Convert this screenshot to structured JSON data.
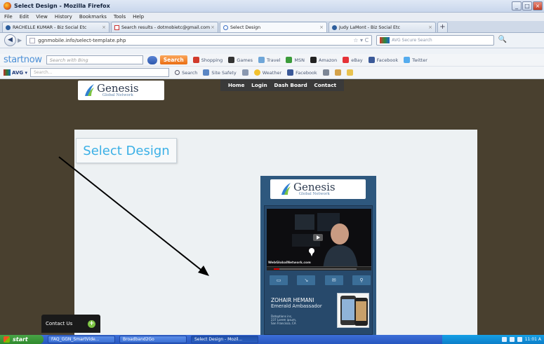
{
  "window": {
    "title": "Select Design - Mozilla Firefox",
    "min": "_",
    "max": "□",
    "close": "×"
  },
  "menu": [
    "File",
    "Edit",
    "View",
    "History",
    "Bookmarks",
    "Tools",
    "Help"
  ],
  "tabs": [
    {
      "label": "RACHELLE KUMAR - Biz Social Etc",
      "icon": "site-icon"
    },
    {
      "label": "Search results - dotmobietc@gmail.com - ...",
      "icon": "gmail-icon"
    },
    {
      "label": "Select Design",
      "icon": "search-icon"
    },
    {
      "label": "Judy LaMont - Biz Social Etc",
      "icon": "site-icon"
    }
  ],
  "tab_close": "×",
  "new_tab": "+",
  "nav": {
    "url": "ggnmobile.info/select-template.php",
    "url_right": "☆ ▾ C",
    "search_placeholder": "AVG Secure Search",
    "search_go": "🔍"
  },
  "startnow_bar": {
    "brand": "startnow",
    "search_placeholder": "Search with Bing",
    "search_button": "Search",
    "items": [
      "Shopping",
      "Games",
      "Travel",
      "MSN",
      "Amazon",
      "eBay",
      "Facebook",
      "Twitter"
    ]
  },
  "avg_bar": {
    "brand": "AVG ▾",
    "search_placeholder": "Search...",
    "items": [
      "Search",
      "Site Safety",
      "Weather",
      "Facebook"
    ]
  },
  "site": {
    "logo_word": "Genesis",
    "logo_sub": "Global Network",
    "nav": [
      "Home",
      "Login",
      "Dash Board",
      "Contact"
    ],
    "heading": "Select Design",
    "contact_label": "Contact Us",
    "contact_plus": "+"
  },
  "preview": {
    "logo_word": "Genesis",
    "logo_sub": "Global Network",
    "video_caption": "WebGlobalNetwork.com",
    "icons": [
      "▭",
      "↘",
      "✉",
      "⚲"
    ],
    "name": "ZOHAIR HEMANI",
    "title": "Emerald Ambassador",
    "address": [
      "Dotoptions inc,",
      "237 Lorem ipsum,",
      "San Francisco, CA"
    ]
  },
  "taskbar": {
    "start": "start",
    "buttons": [
      "FAQ_GGN_SmartVide...",
      "Broadband2Go",
      "Select Design - Mozil..."
    ],
    "time": "11:01 A"
  },
  "colors": {
    "page_bg": "#49402f",
    "heading": "#3bb0e6",
    "preview_bg": "#2e587e"
  }
}
